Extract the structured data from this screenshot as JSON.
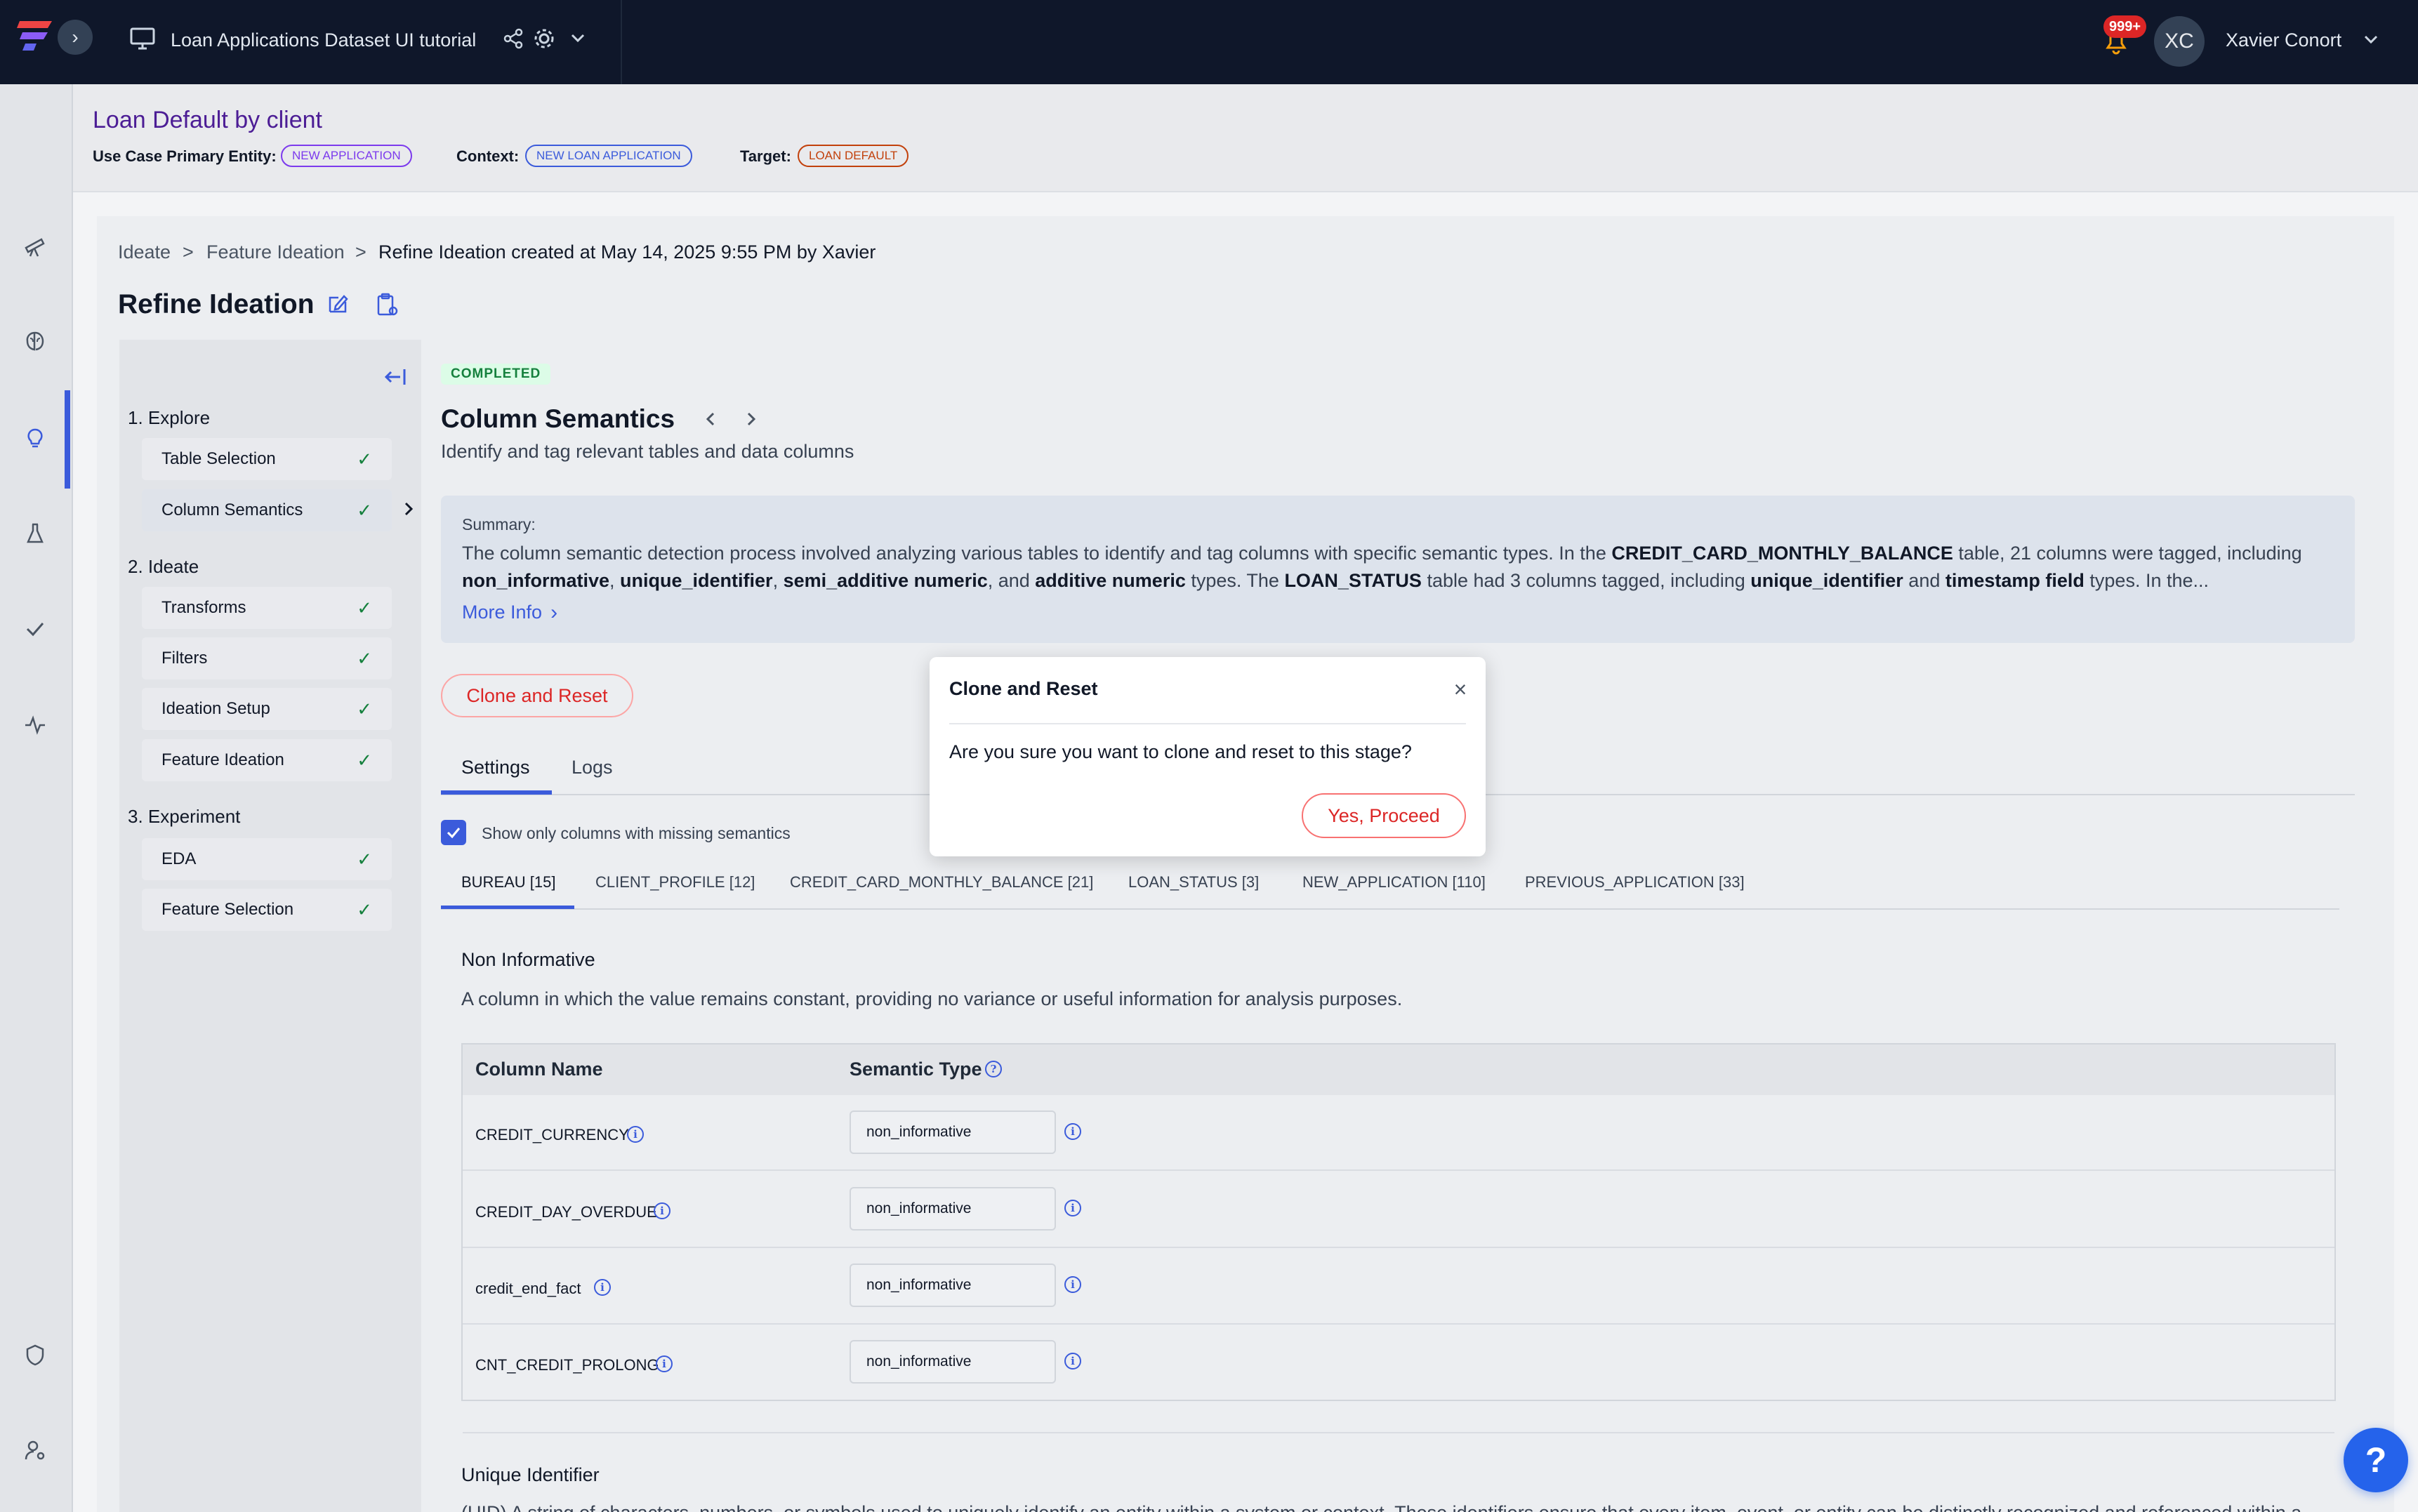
{
  "topbar": {
    "app_title": "Loan Applications Dataset UI tutorial",
    "notifications_badge": "999+",
    "user_initials": "XC",
    "user_name": "Xavier Conort"
  },
  "use_case": {
    "title": "Loan Default by client",
    "primary_entity_label": "Use Case Primary Entity:",
    "primary_entity": "NEW APPLICATION",
    "context_label": "Context:",
    "context": "NEW LOAN APPLICATION",
    "target_label": "Target:",
    "target": "LOAN DEFAULT",
    "colors": {
      "entity": "#7c3aed",
      "context": "#3b5bdb",
      "target": "#c2410c"
    }
  },
  "breadcrumb": {
    "items": [
      "Ideate",
      "Feature Ideation",
      "Refine Ideation created at May 14, 2025 9:55 PM by Xavier"
    ],
    "separator": ">"
  },
  "page": {
    "title": "Refine Ideation"
  },
  "stages": {
    "sections": [
      {
        "title": "1. Explore",
        "items": [
          "Table Selection",
          "Column Semantics"
        ]
      },
      {
        "title": "2. Ideate",
        "items": [
          "Transforms",
          "Filters",
          "Ideation Setup",
          "Feature Ideation"
        ]
      },
      {
        "title": "3. Experiment",
        "items": [
          "EDA",
          "Feature Selection"
        ]
      }
    ],
    "check": "✓",
    "active": "Column Semantics"
  },
  "step": {
    "status": "COMPLETED",
    "title": "Column Semantics",
    "subtitle": "Identify and tag relevant tables and data columns"
  },
  "summary": {
    "label": "Summary:",
    "segments": [
      {
        "t": "The column semantic detection process involved analyzing various tables to identify and tag columns with specific semantic types. In the ",
        "b": false
      },
      {
        "t": "CREDIT_CARD_MONTHLY_BALANCE",
        "b": true
      },
      {
        "t": " table, 21 columns were tagged, including ",
        "b": false
      },
      {
        "t": "non_informative",
        "b": true
      },
      {
        "t": ", ",
        "b": false
      },
      {
        "t": "unique_identifier",
        "b": true
      },
      {
        "t": ", ",
        "b": false
      },
      {
        "t": "semi_additive numeric",
        "b": true
      },
      {
        "t": ", and ",
        "b": false
      },
      {
        "t": "additive numeric",
        "b": true
      },
      {
        "t": " types. The ",
        "b": false
      },
      {
        "t": "LOAN_STATUS",
        "b": true
      },
      {
        "t": " table had 3 columns tagged, including ",
        "b": false
      },
      {
        "t": "unique_identifier",
        "b": true
      },
      {
        "t": " and ",
        "b": false
      },
      {
        "t": "timestamp field",
        "b": true
      },
      {
        "t": " types. In the...",
        "b": false
      }
    ],
    "more_info": "More Info"
  },
  "actions": {
    "clone_reset": "Clone and Reset"
  },
  "tabs": [
    "Settings",
    "Logs"
  ],
  "filter": {
    "label": "Show only columns with missing semantics",
    "checked": true
  },
  "table_tabs": [
    "BUREAU [15]",
    "CLIENT_PROFILE [12]",
    "CREDIT_CARD_MONTHLY_BALANCE [21]",
    "LOAN_STATUS [3]",
    "NEW_APPLICATION [110]",
    "PREVIOUS_APPLICATION [33]"
  ],
  "categories": [
    {
      "title": "Non Informative",
      "description": "A column in which the value remains constant, providing no variance or useful information for analysis purposes."
    },
    {
      "title": "Unique Identifier",
      "description": "(UID) A string of characters, numbers, or symbols used to uniquely identify an entity within a system or context. These identifiers ensure that every item, event, or entity can be distinctly recognized and referenced within a"
    }
  ],
  "columns_table": {
    "headers": [
      "Column Name",
      "Semantic Type"
    ],
    "rows": [
      {
        "name": "CREDIT_CURRENCY",
        "semantic": "non_informative"
      },
      {
        "name": "CREDIT_DAY_OVERDUE",
        "semantic": "non_informative"
      },
      {
        "name": "credit_end_fact",
        "semantic": "non_informative"
      },
      {
        "name": "CNT_CREDIT_PROLONG",
        "semantic": "non_informative"
      }
    ]
  },
  "dialog": {
    "title": "Clone and Reset",
    "message": "Are you sure you want to clone and reset to this stage?",
    "confirm": "Yes, Proceed",
    "close": "×"
  },
  "help": {
    "label": "?"
  }
}
